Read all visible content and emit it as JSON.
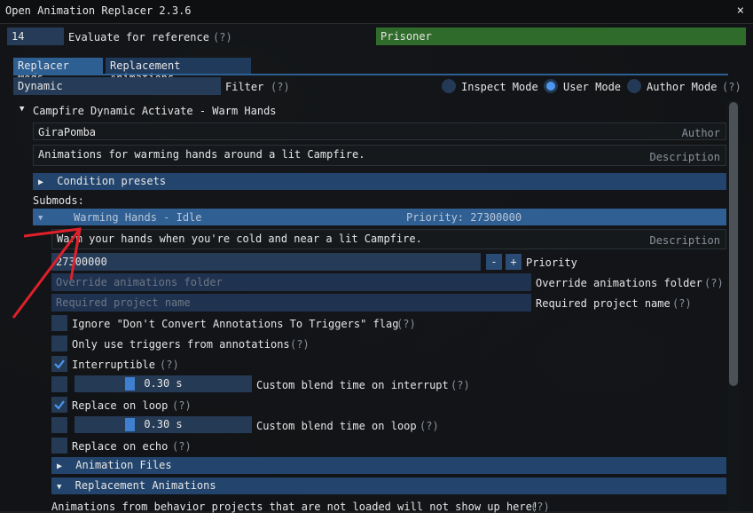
{
  "window": {
    "title": "Open Animation Replacer 2.3.6",
    "close_glyph": "×"
  },
  "eval": {
    "ref_value": "14",
    "label": "Evaluate for reference",
    "hint": "(?)",
    "result": "Prisoner"
  },
  "tabs": [
    {
      "label": "Replacer Mods",
      "active": true
    },
    {
      "label": "Replacement Animations",
      "active": false
    }
  ],
  "filter": {
    "value": "Dynamic",
    "label": "Filter",
    "hint": "(?)"
  },
  "modes": {
    "inspect": "Inspect Mode",
    "user": "User Mode",
    "author": "Author Mode",
    "hint": "(?)",
    "selected": "user"
  },
  "mod": {
    "title": "Campfire Dynamic Activate - Warm Hands",
    "author_value": "GiraPomba",
    "author_tag": "Author",
    "description_value": "Animations for warming hands around a lit Campfire.",
    "description_tag": "Description",
    "condition_presets": "Condition presets",
    "submods_label": "Submods:"
  },
  "submod": {
    "name": "Warming Hands - Idle",
    "priority_header": "Priority: 27300000",
    "description_value": "Warm your hands when you're cold and near a lit Campfire.",
    "description_tag": "Description",
    "priority_value": "27300000",
    "minus": "-",
    "plus": "+",
    "priority_label": "Priority",
    "override_placeholder": "Override animations folder",
    "override_label": "Override animations folder",
    "override_hint": "(?)",
    "project_placeholder": "Required project name",
    "project_label": "Required project name",
    "project_hint": "(?)",
    "opt_ignore_label": "Ignore \"Don't Convert Annotations To Triggers\" flag",
    "opt_ignore_hint": "(?)",
    "opt_ignore_checked": false,
    "opt_triggers_label": "Only use triggers from annotations",
    "opt_triggers_hint": "(?)",
    "opt_triggers_checked": false,
    "opt_interruptible_label": "Interruptible",
    "opt_interruptible_hint": "(?)",
    "opt_interruptible_checked": true,
    "blend_interrupt_checked": false,
    "blend_interrupt_value": "0.30 s",
    "blend_interrupt_fraction": 0.3,
    "blend_interrupt_label": "Custom blend time on interrupt",
    "blend_interrupt_hint": "(?)",
    "opt_loop_label": "Replace on loop",
    "opt_loop_hint": "(?)",
    "opt_loop_checked": true,
    "blend_loop_checked": false,
    "blend_loop_value": "0.30 s",
    "blend_loop_fraction": 0.3,
    "blend_loop_label": "Custom blend time on loop",
    "blend_loop_hint": "(?)",
    "opt_echo_label": "Replace on echo",
    "opt_echo_hint": "(?)",
    "opt_echo_checked": false,
    "animation_files": "Animation Files",
    "replacement_animations": "Replacement Animations",
    "footer_note": "Animations from behavior projects that are not loaded will not show up here!",
    "footer_hint": "(?)"
  },
  "glyphs": {
    "collapsed": "▶",
    "expanded": "▼"
  },
  "colors": {
    "accent": "#4d97ee",
    "result_green": "#2f6b2a",
    "header_blue": "#23456d",
    "selected_blue": "#2f5f93",
    "annotation_red": "#e0202a"
  }
}
